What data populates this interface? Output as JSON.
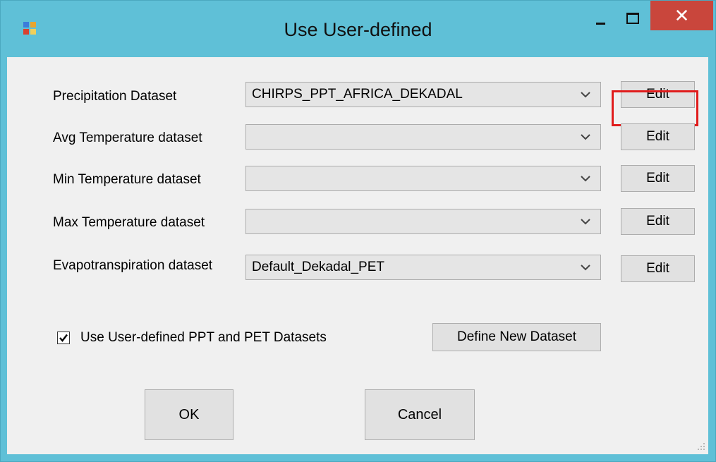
{
  "window": {
    "title": "Use User-defined",
    "close_glyph": "✕",
    "icons": [
      "app-icon",
      "minimize-icon",
      "maximize-icon",
      "close-icon"
    ]
  },
  "rows": [
    {
      "label": "Precipitation Dataset",
      "value": "CHIRPS_PPT_AFRICA_DEKADAL",
      "edit_label": "Edit"
    },
    {
      "label": "Avg Temperature dataset",
      "value": "",
      "edit_label": "Edit"
    },
    {
      "label": "Min Temperature dataset",
      "value": "",
      "edit_label": "Edit"
    },
    {
      "label": "Max Temperature dataset",
      "value": "",
      "edit_label": "Edit"
    },
    {
      "label": "Evapotranspiration dataset",
      "value": "Default_Dekadal_PET",
      "edit_label": "Edit"
    }
  ],
  "options": {
    "use_user_defined_label": "Use User-defined PPT and PET Datasets",
    "use_user_defined_checked": true,
    "define_new_label": "Define New Dataset"
  },
  "actions": {
    "ok_label": "OK",
    "cancel_label": "Cancel"
  },
  "colors": {
    "titlebar": "#5fc0d7",
    "close_button": "#c9463c",
    "highlight_border": "#e01c1c",
    "client_background": "#f0f0f0"
  }
}
